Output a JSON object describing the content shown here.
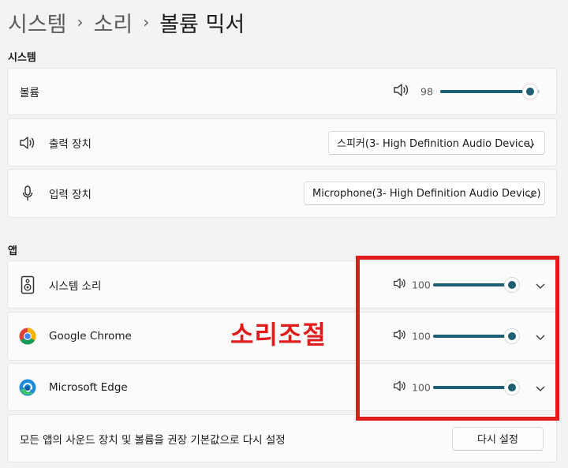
{
  "breadcrumb": [
    "시스템",
    "소리",
    "볼륨 믹서"
  ],
  "system_section": {
    "title": "시스템",
    "volume": {
      "label": "볼륨",
      "value": "98",
      "level": 98
    },
    "output": {
      "label": "출력 장치",
      "selected": "스피커(3- High Definition Audio Device)"
    },
    "input": {
      "label": "입력 장치",
      "selected": "Microphone(3- High Definition Audio Device)"
    }
  },
  "apps_section": {
    "title": "앱",
    "apps": [
      {
        "name": "시스템 소리",
        "icon": "speaker-device-icon",
        "value": "100",
        "level": 100
      },
      {
        "name": "Google Chrome",
        "icon": "chrome-icon",
        "value": "100",
        "level": 100
      },
      {
        "name": "Microsoft Edge",
        "icon": "edge-icon",
        "value": "100",
        "level": 100
      }
    ]
  },
  "reset": {
    "description": "모든 앱의 사운드 장치 및 볼륨을 권장 기본값으로 다시 설정",
    "button_label": "다시 설정"
  },
  "annotation": {
    "text": "소리조절",
    "color": "#e01b1b"
  },
  "colors": {
    "accent": "#1f5f73",
    "background": "#f3f3f3",
    "card": "#fbfbfb"
  }
}
